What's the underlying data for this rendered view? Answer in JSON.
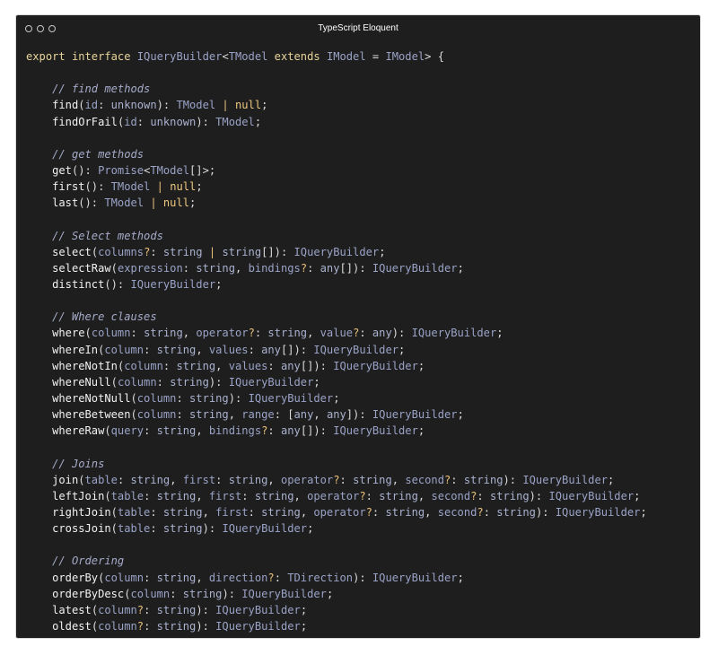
{
  "window": {
    "title": "TypeScript Eloquent",
    "controls": [
      "close-circle",
      "minimize-circle",
      "maximize-circle"
    ]
  },
  "colors": {
    "background": "#1e1e1e",
    "keyword": "#e8d49a",
    "type": "#9aa3c7",
    "comment": "#a6abc9",
    "operator": "#e8c07a",
    "method": "#f2f2f2"
  },
  "code": [
    [
      [
        "k",
        "export interface "
      ],
      [
        "t",
        "IQueryBuilder"
      ],
      [
        "d",
        "<"
      ],
      [
        "t",
        "TModel"
      ],
      [
        "k",
        " extends "
      ],
      [
        "t",
        "IModel"
      ],
      [
        "d",
        " = "
      ],
      [
        "t",
        "IModel"
      ],
      [
        "d",
        "> {"
      ]
    ],
    [],
    [
      [
        "d",
        "    "
      ],
      [
        "c",
        "// find methods"
      ]
    ],
    [
      [
        "d",
        "    "
      ],
      [
        "f",
        "find"
      ],
      [
        "d",
        "("
      ],
      [
        "p",
        "id"
      ],
      [
        "d",
        ": "
      ],
      [
        "s",
        "unknown"
      ],
      [
        "d",
        "): "
      ],
      [
        "t",
        "TModel"
      ],
      [
        "o",
        " | "
      ],
      [
        "n",
        "null"
      ],
      [
        "d",
        ";"
      ]
    ],
    [
      [
        "d",
        "    "
      ],
      [
        "f",
        "findOrFail"
      ],
      [
        "d",
        "("
      ],
      [
        "p",
        "id"
      ],
      [
        "d",
        ": "
      ],
      [
        "s",
        "unknown"
      ],
      [
        "d",
        "): "
      ],
      [
        "t",
        "TModel"
      ],
      [
        "d",
        ";"
      ]
    ],
    [],
    [
      [
        "d",
        "    "
      ],
      [
        "c",
        "// get methods"
      ]
    ],
    [
      [
        "d",
        "    "
      ],
      [
        "f",
        "get"
      ],
      [
        "d",
        "(): "
      ],
      [
        "t",
        "Promise"
      ],
      [
        "d",
        "<"
      ],
      [
        "t",
        "TModel"
      ],
      [
        "d",
        "[]>;"
      ]
    ],
    [
      [
        "d",
        "    "
      ],
      [
        "f",
        "first"
      ],
      [
        "d",
        "(): "
      ],
      [
        "t",
        "TModel"
      ],
      [
        "o",
        " | "
      ],
      [
        "n",
        "null"
      ],
      [
        "d",
        ";"
      ]
    ],
    [
      [
        "d",
        "    "
      ],
      [
        "f",
        "last"
      ],
      [
        "d",
        "(): "
      ],
      [
        "t",
        "TModel"
      ],
      [
        "o",
        " | "
      ],
      [
        "n",
        "null"
      ],
      [
        "d",
        ";"
      ]
    ],
    [],
    [
      [
        "d",
        "    "
      ],
      [
        "c",
        "// Select methods"
      ]
    ],
    [
      [
        "d",
        "    "
      ],
      [
        "f",
        "select"
      ],
      [
        "d",
        "("
      ],
      [
        "p",
        "columns"
      ],
      [
        "o",
        "?"
      ],
      [
        "d",
        ": "
      ],
      [
        "s",
        "string"
      ],
      [
        "o",
        " | "
      ],
      [
        "s",
        "string"
      ],
      [
        "d",
        "[]): "
      ],
      [
        "t",
        "IQueryBuilder"
      ],
      [
        "d",
        ";"
      ]
    ],
    [
      [
        "d",
        "    "
      ],
      [
        "f",
        "selectRaw"
      ],
      [
        "d",
        "("
      ],
      [
        "p",
        "expression"
      ],
      [
        "d",
        ": "
      ],
      [
        "s",
        "string"
      ],
      [
        "d",
        ", "
      ],
      [
        "p",
        "bindings"
      ],
      [
        "o",
        "?"
      ],
      [
        "d",
        ": "
      ],
      [
        "s",
        "any"
      ],
      [
        "d",
        "[]): "
      ],
      [
        "t",
        "IQueryBuilder"
      ],
      [
        "d",
        ";"
      ]
    ],
    [
      [
        "d",
        "    "
      ],
      [
        "f",
        "distinct"
      ],
      [
        "d",
        "(): "
      ],
      [
        "t",
        "IQueryBuilder"
      ],
      [
        "d",
        ";"
      ]
    ],
    [],
    [
      [
        "d",
        "    "
      ],
      [
        "c",
        "// Where clauses"
      ]
    ],
    [
      [
        "d",
        "    "
      ],
      [
        "f",
        "where"
      ],
      [
        "d",
        "("
      ],
      [
        "p",
        "column"
      ],
      [
        "d",
        ": "
      ],
      [
        "s",
        "string"
      ],
      [
        "d",
        ", "
      ],
      [
        "p",
        "operator"
      ],
      [
        "o",
        "?"
      ],
      [
        "d",
        ": "
      ],
      [
        "s",
        "string"
      ],
      [
        "d",
        ", "
      ],
      [
        "p",
        "value"
      ],
      [
        "o",
        "?"
      ],
      [
        "d",
        ": "
      ],
      [
        "s",
        "any"
      ],
      [
        "d",
        "): "
      ],
      [
        "t",
        "IQueryBuilder"
      ],
      [
        "d",
        ";"
      ]
    ],
    [
      [
        "d",
        "    "
      ],
      [
        "f",
        "whereIn"
      ],
      [
        "d",
        "("
      ],
      [
        "p",
        "column"
      ],
      [
        "d",
        ": "
      ],
      [
        "s",
        "string"
      ],
      [
        "d",
        ", "
      ],
      [
        "p",
        "values"
      ],
      [
        "d",
        ": "
      ],
      [
        "s",
        "any"
      ],
      [
        "d",
        "[]): "
      ],
      [
        "t",
        "IQueryBuilder"
      ],
      [
        "d",
        ";"
      ]
    ],
    [
      [
        "d",
        "    "
      ],
      [
        "f",
        "whereNotIn"
      ],
      [
        "d",
        "("
      ],
      [
        "p",
        "column"
      ],
      [
        "d",
        ": "
      ],
      [
        "s",
        "string"
      ],
      [
        "d",
        ", "
      ],
      [
        "p",
        "values"
      ],
      [
        "d",
        ": "
      ],
      [
        "s",
        "any"
      ],
      [
        "d",
        "[]): "
      ],
      [
        "t",
        "IQueryBuilder"
      ],
      [
        "d",
        ";"
      ]
    ],
    [
      [
        "d",
        "    "
      ],
      [
        "f",
        "whereNull"
      ],
      [
        "d",
        "("
      ],
      [
        "p",
        "column"
      ],
      [
        "d",
        ": "
      ],
      [
        "s",
        "string"
      ],
      [
        "d",
        "): "
      ],
      [
        "t",
        "IQueryBuilder"
      ],
      [
        "d",
        ";"
      ]
    ],
    [
      [
        "d",
        "    "
      ],
      [
        "f",
        "whereNotNull"
      ],
      [
        "d",
        "("
      ],
      [
        "p",
        "column"
      ],
      [
        "d",
        ": "
      ],
      [
        "s",
        "string"
      ],
      [
        "d",
        "): "
      ],
      [
        "t",
        "IQueryBuilder"
      ],
      [
        "d",
        ";"
      ]
    ],
    [
      [
        "d",
        "    "
      ],
      [
        "f",
        "whereBetween"
      ],
      [
        "d",
        "("
      ],
      [
        "p",
        "column"
      ],
      [
        "d",
        ": "
      ],
      [
        "s",
        "string"
      ],
      [
        "d",
        ", "
      ],
      [
        "p",
        "range"
      ],
      [
        "d",
        ": ["
      ],
      [
        "s",
        "any"
      ],
      [
        "d",
        ", "
      ],
      [
        "s",
        "any"
      ],
      [
        "d",
        "]): "
      ],
      [
        "t",
        "IQueryBuilder"
      ],
      [
        "d",
        ";"
      ]
    ],
    [
      [
        "d",
        "    "
      ],
      [
        "f",
        "whereRaw"
      ],
      [
        "d",
        "("
      ],
      [
        "p",
        "query"
      ],
      [
        "d",
        ": "
      ],
      [
        "s",
        "string"
      ],
      [
        "d",
        ", "
      ],
      [
        "p",
        "bindings"
      ],
      [
        "o",
        "?"
      ],
      [
        "d",
        ": "
      ],
      [
        "s",
        "any"
      ],
      [
        "d",
        "[]): "
      ],
      [
        "t",
        "IQueryBuilder"
      ],
      [
        "d",
        ";"
      ]
    ],
    [],
    [
      [
        "d",
        "    "
      ],
      [
        "c",
        "// Joins"
      ]
    ],
    [
      [
        "d",
        "    "
      ],
      [
        "f",
        "join"
      ],
      [
        "d",
        "("
      ],
      [
        "p",
        "table"
      ],
      [
        "d",
        ": "
      ],
      [
        "s",
        "string"
      ],
      [
        "d",
        ", "
      ],
      [
        "p",
        "first"
      ],
      [
        "d",
        ": "
      ],
      [
        "s",
        "string"
      ],
      [
        "d",
        ", "
      ],
      [
        "p",
        "operator"
      ],
      [
        "o",
        "?"
      ],
      [
        "d",
        ": "
      ],
      [
        "s",
        "string"
      ],
      [
        "d",
        ", "
      ],
      [
        "p",
        "second"
      ],
      [
        "o",
        "?"
      ],
      [
        "d",
        ": "
      ],
      [
        "s",
        "string"
      ],
      [
        "d",
        "): "
      ],
      [
        "t",
        "IQueryBuilder"
      ],
      [
        "d",
        ";"
      ]
    ],
    [
      [
        "d",
        "    "
      ],
      [
        "f",
        "leftJoin"
      ],
      [
        "d",
        "("
      ],
      [
        "p",
        "table"
      ],
      [
        "d",
        ": "
      ],
      [
        "s",
        "string"
      ],
      [
        "d",
        ", "
      ],
      [
        "p",
        "first"
      ],
      [
        "d",
        ": "
      ],
      [
        "s",
        "string"
      ],
      [
        "d",
        ", "
      ],
      [
        "p",
        "operator"
      ],
      [
        "o",
        "?"
      ],
      [
        "d",
        ": "
      ],
      [
        "s",
        "string"
      ],
      [
        "d",
        ", "
      ],
      [
        "p",
        "second"
      ],
      [
        "o",
        "?"
      ],
      [
        "d",
        ": "
      ],
      [
        "s",
        "string"
      ],
      [
        "d",
        "): "
      ],
      [
        "t",
        "IQueryBuilder"
      ],
      [
        "d",
        ";"
      ]
    ],
    [
      [
        "d",
        "    "
      ],
      [
        "f",
        "rightJoin"
      ],
      [
        "d",
        "("
      ],
      [
        "p",
        "table"
      ],
      [
        "d",
        ": "
      ],
      [
        "s",
        "string"
      ],
      [
        "d",
        ", "
      ],
      [
        "p",
        "first"
      ],
      [
        "d",
        ": "
      ],
      [
        "s",
        "string"
      ],
      [
        "d",
        ", "
      ],
      [
        "p",
        "operator"
      ],
      [
        "o",
        "?"
      ],
      [
        "d",
        ": "
      ],
      [
        "s",
        "string"
      ],
      [
        "d",
        ", "
      ],
      [
        "p",
        "second"
      ],
      [
        "o",
        "?"
      ],
      [
        "d",
        ": "
      ],
      [
        "s",
        "string"
      ],
      [
        "d",
        "): "
      ],
      [
        "t",
        "IQueryBuilder"
      ],
      [
        "d",
        ";"
      ]
    ],
    [
      [
        "d",
        "    "
      ],
      [
        "f",
        "crossJoin"
      ],
      [
        "d",
        "("
      ],
      [
        "p",
        "table"
      ],
      [
        "d",
        ": "
      ],
      [
        "s",
        "string"
      ],
      [
        "d",
        "): "
      ],
      [
        "t",
        "IQueryBuilder"
      ],
      [
        "d",
        ";"
      ]
    ],
    [],
    [
      [
        "d",
        "    "
      ],
      [
        "c",
        "// Ordering"
      ]
    ],
    [
      [
        "d",
        "    "
      ],
      [
        "f",
        "orderBy"
      ],
      [
        "d",
        "("
      ],
      [
        "p",
        "column"
      ],
      [
        "d",
        ": "
      ],
      [
        "s",
        "string"
      ],
      [
        "d",
        ", "
      ],
      [
        "p",
        "direction"
      ],
      [
        "o",
        "?"
      ],
      [
        "d",
        ": "
      ],
      [
        "t",
        "TDirection"
      ],
      [
        "d",
        "): "
      ],
      [
        "t",
        "IQueryBuilder"
      ],
      [
        "d",
        ";"
      ]
    ],
    [
      [
        "d",
        "    "
      ],
      [
        "f",
        "orderByDesc"
      ],
      [
        "d",
        "("
      ],
      [
        "p",
        "column"
      ],
      [
        "d",
        ": "
      ],
      [
        "s",
        "string"
      ],
      [
        "d",
        "): "
      ],
      [
        "t",
        "IQueryBuilder"
      ],
      [
        "d",
        ";"
      ]
    ],
    [
      [
        "d",
        "    "
      ],
      [
        "f",
        "latest"
      ],
      [
        "d",
        "("
      ],
      [
        "p",
        "column"
      ],
      [
        "o",
        "?"
      ],
      [
        "d",
        ": "
      ],
      [
        "s",
        "string"
      ],
      [
        "d",
        "): "
      ],
      [
        "t",
        "IQueryBuilder"
      ],
      [
        "d",
        ";"
      ]
    ],
    [
      [
        "d",
        "    "
      ],
      [
        "f",
        "oldest"
      ],
      [
        "d",
        "("
      ],
      [
        "p",
        "column"
      ],
      [
        "o",
        "?"
      ],
      [
        "d",
        ": "
      ],
      [
        "s",
        "string"
      ],
      [
        "d",
        "): "
      ],
      [
        "t",
        "IQueryBuilder"
      ],
      [
        "d",
        ";"
      ]
    ]
  ]
}
